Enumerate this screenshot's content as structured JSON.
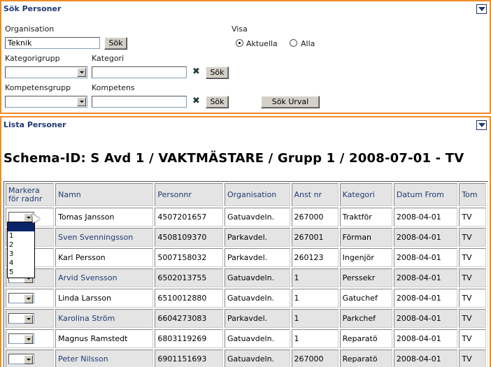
{
  "search": {
    "title": "Sök Personer",
    "organisation_label": "Organisation",
    "organisation_value": "Teknik",
    "search_label": "Sök",
    "visa_label": "Visa",
    "radio_aktuella": "Aktuella",
    "radio_alla": "Alla",
    "kategorigrupp_label": "Kategorigrupp",
    "kategori_label": "Kategori",
    "kompetensgrupp_label": "Kompetensgrupp",
    "kompetens_label": "Kompetens",
    "clear_glyph": "✖",
    "sok_urval_label": "Sök Urval"
  },
  "list": {
    "title": "Lista Personer",
    "heading": "Schema-ID: S Avd 1 / VAKTMÄSTARE / Grupp 1 / 2008-07-01 - TV",
    "headers": {
      "markera": "Markera för radnr",
      "namn": "Namn",
      "personnr": "Personnr",
      "organisation": "Organisation",
      "anst_nr": "Anst nr",
      "kategori": "Kategori",
      "datum_from": "Datum From",
      "tom": "Tom"
    },
    "rows": [
      {
        "namn": "Tomas Jansson",
        "personnr": "4507201657",
        "organisation": "Gatuavdeln.",
        "anst_nr": "267000",
        "kategori": "Traktför",
        "datum_from": "2008-04-01",
        "tom": "TV"
      },
      {
        "namn": "Sven Svenningsson",
        "personnr": "4508109370",
        "organisation": "Parkavdel.",
        "anst_nr": "267001",
        "kategori": "Förman",
        "datum_from": "2008-04-01",
        "tom": "TV"
      },
      {
        "namn": "Karl Persson",
        "personnr": "5007158032",
        "organisation": "Parkavdel.",
        "anst_nr": "260123",
        "kategori": "Ingenjör",
        "datum_from": "2008-04-01",
        "tom": "TV"
      },
      {
        "namn": "Arvid Svensson",
        "personnr": "6502013755",
        "organisation": "Gatuavdeln.",
        "anst_nr": "1",
        "kategori": "Perssekr",
        "datum_from": "2008-04-01",
        "tom": "TV"
      },
      {
        "namn": "Linda Larsson",
        "personnr": "6510012880",
        "organisation": "Gatuavdeln.",
        "anst_nr": "1",
        "kategori": "Gatuchef",
        "datum_from": "2008-04-01",
        "tom": "TV"
      },
      {
        "namn": "Karolina Ström",
        "personnr": "6604273083",
        "organisation": "Parkavdel.",
        "anst_nr": "1",
        "kategori": "Parkchef",
        "datum_from": "2008-04-01",
        "tom": "TV"
      },
      {
        "namn": "Magnus Ramstedt",
        "personnr": "6803119269",
        "organisation": "Gatuavdeln.",
        "anst_nr": "1",
        "kategori": "Reparatö",
        "datum_from": "2008-04-01",
        "tom": "TV"
      },
      {
        "namn": "Peter Nilsson",
        "personnr": "6901151693",
        "organisation": "Gatuavdeln.",
        "anst_nr": "267000",
        "kategori": "Reparatö",
        "datum_from": "2008-04-01",
        "tom": "TV"
      }
    ],
    "dropdown_options": [
      "",
      "1",
      "2",
      "3",
      "4",
      "5"
    ]
  }
}
